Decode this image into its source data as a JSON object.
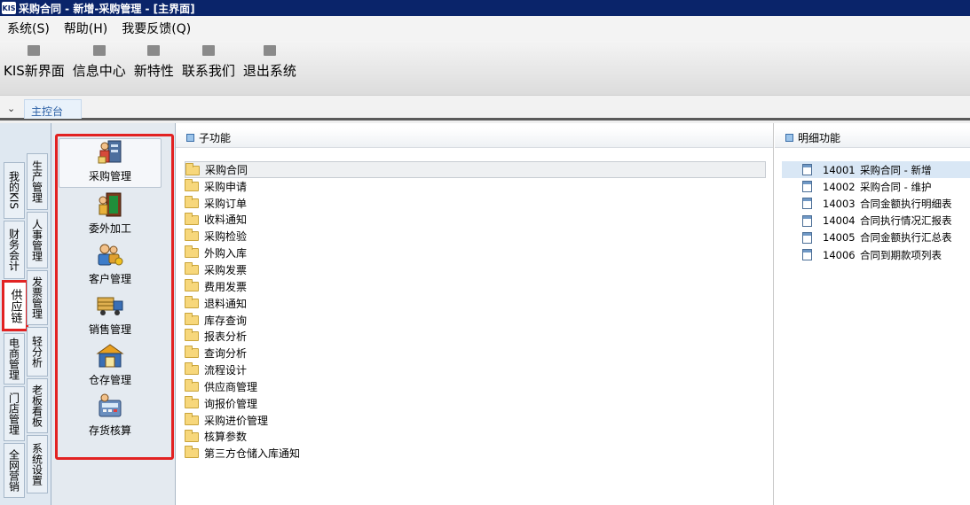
{
  "window": {
    "logo": "KIS",
    "title": "采购合同 - 新增-采购管理 - [主界面]"
  },
  "menu": [
    {
      "label": "系统(S)"
    },
    {
      "label": "帮助(H)"
    },
    {
      "label": "我要反馈(Q)"
    }
  ],
  "toolbar": [
    {
      "label": "KIS新界面",
      "icon": "layout-icon"
    },
    {
      "label": "信息中心",
      "icon": "mail-icon"
    },
    {
      "label": "新特性",
      "icon": "star-icon"
    },
    {
      "label": "联系我们",
      "icon": "chat-icon"
    },
    {
      "label": "退出系统",
      "icon": "exit-icon"
    }
  ],
  "tabs": {
    "main_tab": "主控台"
  },
  "vertical_tabs": {
    "outer": [
      "我的KIS",
      "财务会计",
      "供应链",
      "电商管理",
      "门店管理",
      "全网营销"
    ],
    "inner": [
      "生产管理",
      "人事管理",
      "发票管理",
      "轻分析",
      "老板看板",
      "系统设置"
    ],
    "selected": "供应链"
  },
  "modules": [
    {
      "label": "采购管理",
      "icon": "purchase-icon",
      "selected": true
    },
    {
      "label": "委外加工",
      "icon": "outsource-icon"
    },
    {
      "label": "客户管理",
      "icon": "customer-icon"
    },
    {
      "label": "销售管理",
      "icon": "sales-truck-icon"
    },
    {
      "label": "仓存管理",
      "icon": "warehouse-icon"
    },
    {
      "label": "存货核算",
      "icon": "inventory-calc-icon"
    }
  ],
  "subfunctions": {
    "header": "子功能",
    "items": [
      "采购合同",
      "采购申请",
      "采购订单",
      "收料通知",
      "采购检验",
      "外购入库",
      "采购发票",
      "费用发票",
      "退料通知",
      "库存查询",
      "报表分析",
      "查询分析",
      "流程设计",
      "供应商管理",
      "询报价管理",
      "采购进价管理",
      "核算参数",
      "第三方仓储入库通知"
    ],
    "selected": "采购合同"
  },
  "details": {
    "header": "明细功能",
    "items": [
      {
        "code": "14001",
        "name": "采购合同 - 新增"
      },
      {
        "code": "14002",
        "name": "采购合同 - 维护"
      },
      {
        "code": "14003",
        "name": "合同金额执行明细表"
      },
      {
        "code": "14004",
        "name": "合同执行情况汇报表"
      },
      {
        "code": "14005",
        "name": "合同金额执行汇总表"
      },
      {
        "code": "14006",
        "name": "合同到期款项列表"
      }
    ],
    "selected": "14001"
  },
  "colors": {
    "titlebar": "#0a246a",
    "highlight": "#e22222",
    "selection": "#d9e7f5"
  }
}
